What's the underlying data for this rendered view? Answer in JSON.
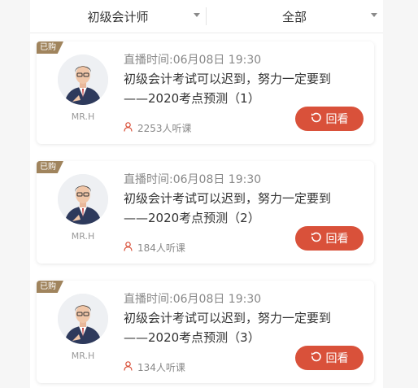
{
  "filters": {
    "category": "初级会计师",
    "status": "全部"
  },
  "colors": {
    "accent": "#d9513a",
    "badge": "#a0845d"
  },
  "lectures": [
    {
      "badge": "已购",
      "author": "MR.H",
      "time": "直播时间:06月08日 19:30",
      "title_line1": "初级会计考试可以迟到，努力一定要到",
      "title_line2": "——2020考点预测（1）",
      "listeners": "2253人听课",
      "action": "回看"
    },
    {
      "badge": "已购",
      "author": "MR.H",
      "time": "直播时间:06月08日 19:30",
      "title_line1": "初级会计考试可以迟到，努力一定要到",
      "title_line2": "——2020考点预测（2）",
      "listeners": "184人听课",
      "action": "回看"
    },
    {
      "badge": "已购",
      "author": "MR.H",
      "time": "直播时间:06月08日 19:30",
      "title_line1": "初级会计考试可以迟到，努力一定要到",
      "title_line2": "——2020考点预测（3）",
      "listeners": "134人听课",
      "action": "回看"
    }
  ]
}
